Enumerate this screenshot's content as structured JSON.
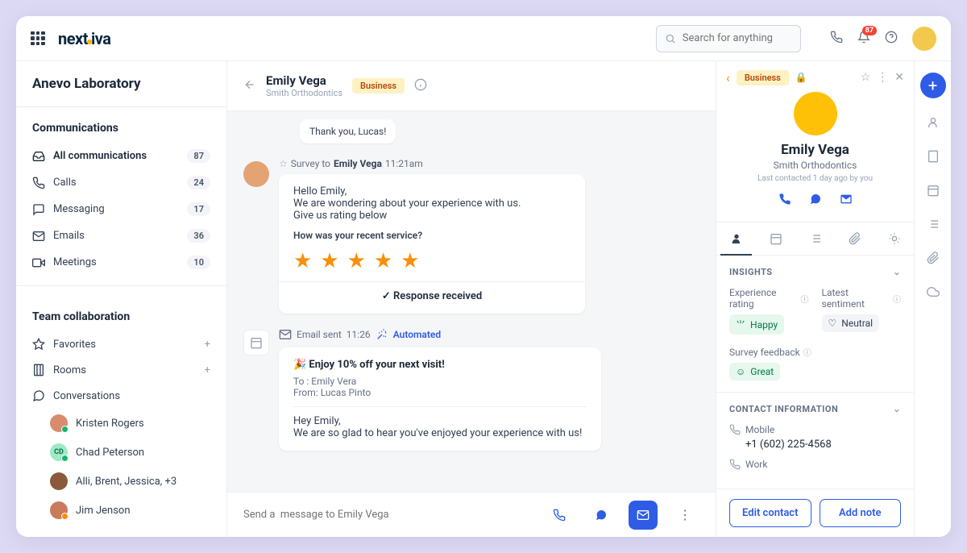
{
  "topbar": {
    "logo": "nextiva",
    "search_placeholder": "Search for anything",
    "notification_count": "87"
  },
  "sidebar": {
    "org": "Anevo Laboratory",
    "section_comm": "Communications",
    "items": [
      {
        "label": "All communications",
        "count": "87"
      },
      {
        "label": "Calls",
        "count": "24"
      },
      {
        "label": "Messaging",
        "count": "17"
      },
      {
        "label": "Emails",
        "count": "36"
      },
      {
        "label": "Meetings",
        "count": "10"
      }
    ],
    "section_team": "Team collaboration",
    "favorites": "Favorites",
    "rooms": "Rooms",
    "conversations": "Conversations",
    "convs": [
      {
        "name": "Kristen Rogers"
      },
      {
        "name": "Chad Peterson"
      },
      {
        "name": "Alli, Brent, Jessica, +3"
      },
      {
        "name": "Jim Jenson"
      }
    ]
  },
  "center": {
    "name": "Emily Vega",
    "sub": "Smith Orthodontics",
    "tag": "Business",
    "thankyou": "Thank you, Lucas!",
    "survey_prefix": "Survey to",
    "survey_to": "Emily Vega",
    "survey_time": "11:21am",
    "survey_line1": "Hello Emily,",
    "survey_line2": "We are wondering about your experience with us.",
    "survey_line3": "Give us rating below",
    "survey_q": "How was your recent service?",
    "response_received": "Response received",
    "email_prefix": "Email sent",
    "email_time": "11:26",
    "automated": "Automated",
    "email_subject": "🎉 Enjoy 10% off your next visit!",
    "email_to_label": "To :",
    "email_to": "Emily Vera",
    "email_from_label": "From:",
    "email_from": "Lucas Pinto",
    "email_body1": "Hey Emily,",
    "email_body2": "We are so glad to hear you've enjoyed your experience with us!",
    "compose_placeholder": "Send a  message to Emily Vega"
  },
  "rpanel": {
    "tag": "Business",
    "name": "Emily Vega",
    "sub": "Smith Orthodontics",
    "last": "Last contacted 1 day ago by you",
    "insights_title": "INSIGHTS",
    "exp_label": "Experience rating",
    "exp_value": "Happy",
    "sent_label": "Latest sentiment",
    "sent_value": "Neutral",
    "survey_label": "Survey feedback",
    "survey_value": "Great",
    "contact_title": "CONTACT INFORMATION",
    "mobile_label": "Mobile",
    "mobile_value": "+1 (602) 225-4568",
    "work_label": "Work",
    "edit_btn": "Edit contact",
    "note_btn": "Add note"
  }
}
